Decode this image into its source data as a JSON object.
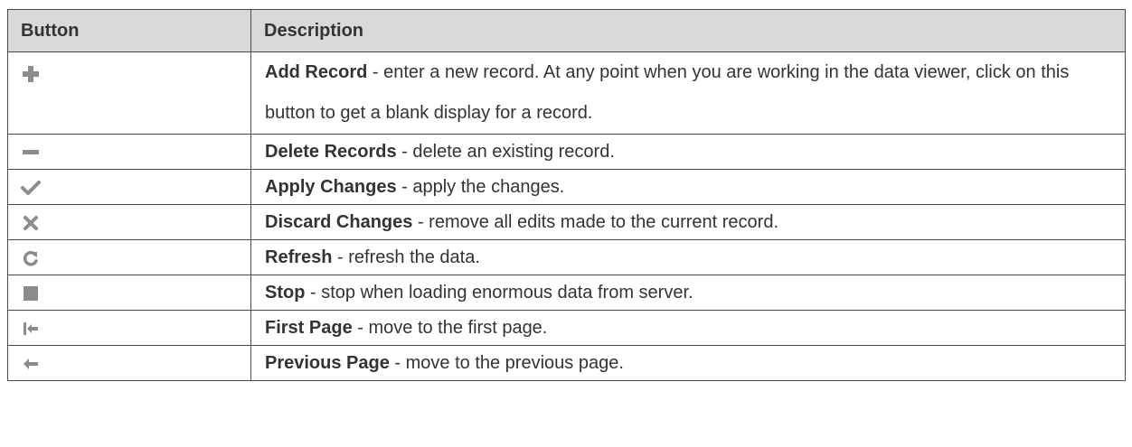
{
  "table": {
    "headers": {
      "button": "Button",
      "description": "Description"
    },
    "rows": [
      {
        "icon": "plus-icon",
        "label": "Add Record",
        "separator": " - ",
        "text": "enter a new record. At any point when you are working in the data viewer, click on this button to get a blank display for a record."
      },
      {
        "icon": "minus-icon",
        "label": "Delete Records",
        "separator": " - ",
        "text": "delete an existing record."
      },
      {
        "icon": "checkmark-icon",
        "label": "Apply Changes",
        "separator": " - ",
        "text": "apply the changes."
      },
      {
        "icon": "close-icon",
        "label": "Discard Changes",
        "separator": " - ",
        "text": "remove all edits made to the current record."
      },
      {
        "icon": "refresh-icon",
        "label": "Refresh",
        "separator": " - ",
        "text": "refresh the data."
      },
      {
        "icon": "stop-icon",
        "label": "Stop",
        "separator": " - ",
        "text": "stop when loading enormous data from server."
      },
      {
        "icon": "first-page-icon",
        "label": "First Page",
        "separator": " - ",
        "text": "move to the first page."
      },
      {
        "icon": "previous-page-icon",
        "label": "Previous Page",
        "separator": " - ",
        "text": "move to the previous page."
      }
    ]
  },
  "colors": {
    "header_background": "#d9d9d9",
    "border": "#4a4a4a",
    "icon": "#8c8c8c",
    "text": "#333333"
  }
}
